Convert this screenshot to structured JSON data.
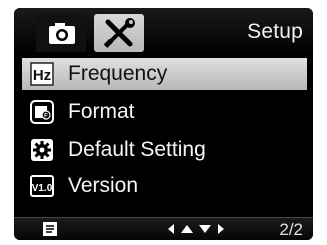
{
  "header": {
    "title": "Setup",
    "tabs": [
      {
        "icon": "camera-icon"
      },
      {
        "icon": "tools-icon",
        "active": true
      }
    ]
  },
  "menu": {
    "items": [
      {
        "label": "Frequency",
        "icon": "hz-icon",
        "selected": true
      },
      {
        "label": "Format",
        "icon": "format-icon"
      },
      {
        "label": "Default Setting",
        "icon": "default-setting-icon"
      },
      {
        "label": "Version",
        "icon": "version-icon",
        "icon_text": "V1.0"
      }
    ]
  },
  "footer": {
    "page_indicator": "2/2",
    "menu_icon": "menu-icon",
    "nav_icon": "arrows-icon"
  },
  "colors": {
    "screen_bg": "#000000",
    "highlight": "#c8c8c8",
    "text": "#f5f5f5"
  }
}
